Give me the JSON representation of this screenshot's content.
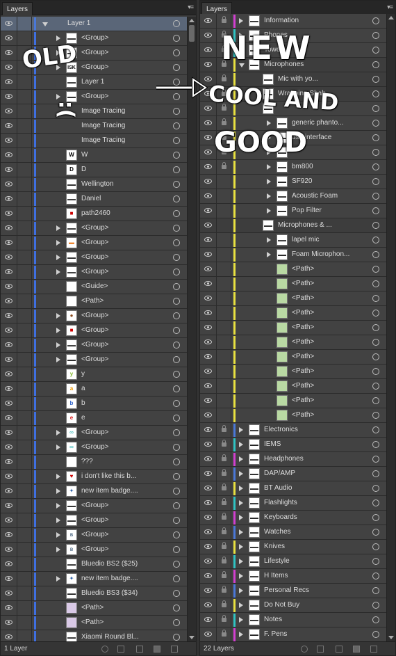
{
  "left": {
    "tab": "Layers",
    "footer_count": "1 Layer",
    "rows": [
      {
        "name": "Layer 1",
        "depth": 0,
        "expand": "down",
        "thumb": "",
        "sel": true,
        "lock": false,
        "color": "#4a78d8"
      },
      {
        "name": "<Group>",
        "depth": 1,
        "expand": "right",
        "thumb": "img",
        "color": "#3f6fe0"
      },
      {
        "name": "<Group>",
        "depth": 1,
        "expand": "right",
        "thumb": "img",
        "color": "#3f6fe0"
      },
      {
        "name": "<Group>",
        "depth": 1,
        "expand": "right",
        "thumb": "ISK",
        "color": "#3f6fe0"
      },
      {
        "name": "Layer 1",
        "depth": 1,
        "expand": "",
        "thumb": "img",
        "color": "#3f6fe0"
      },
      {
        "name": "<Group>",
        "depth": 1,
        "expand": "right",
        "thumb": "img",
        "color": "#3f6fe0"
      },
      {
        "name": "Image Tracing",
        "depth": 1,
        "expand": "",
        "thumb": "",
        "color": "#3f6fe0"
      },
      {
        "name": "Image Tracing",
        "depth": 1,
        "expand": "",
        "thumb": "",
        "color": "#3f6fe0"
      },
      {
        "name": "Image Tracing",
        "depth": 1,
        "expand": "",
        "thumb": "",
        "color": "#3f6fe0"
      },
      {
        "name": "W",
        "depth": 1,
        "expand": "",
        "thumb": "W",
        "color": "#3f6fe0"
      },
      {
        "name": "D",
        "depth": 1,
        "expand": "",
        "thumb": "D",
        "color": "#3f6fe0"
      },
      {
        "name": "Wellington",
        "depth": 1,
        "expand": "",
        "thumb": "img",
        "color": "#3f6fe0"
      },
      {
        "name": "Daniel",
        "depth": 1,
        "expand": "",
        "thumb": "img",
        "color": "#3f6fe0"
      },
      {
        "name": "path2460",
        "depth": 1,
        "expand": "",
        "thumb": "red",
        "color": "#3f6fe0"
      },
      {
        "name": "<Group>",
        "depth": 1,
        "expand": "right",
        "thumb": "img",
        "color": "#3f6fe0"
      },
      {
        "name": "<Group>",
        "depth": 1,
        "expand": "right",
        "thumb": "multi",
        "color": "#3f6fe0"
      },
      {
        "name": "<Group>",
        "depth": 1,
        "expand": "right",
        "thumb": "img",
        "color": "#3f6fe0"
      },
      {
        "name": "<Group>",
        "depth": 1,
        "expand": "right",
        "thumb": "img",
        "color": "#3f6fe0"
      },
      {
        "name": "<Guide>",
        "depth": 1,
        "expand": "",
        "thumb": "blank",
        "color": "#3f6fe0"
      },
      {
        "name": "<Path>",
        "depth": 1,
        "expand": "",
        "thumb": "blank",
        "color": "#3f6fe0"
      },
      {
        "name": "<Group>",
        "depth": 1,
        "expand": "right",
        "thumb": "brown",
        "color": "#3f6fe0"
      },
      {
        "name": "<Group>",
        "depth": 1,
        "expand": "right",
        "thumb": "red",
        "color": "#3f6fe0"
      },
      {
        "name": "<Group>",
        "depth": 1,
        "expand": "right",
        "thumb": "img",
        "color": "#3f6fe0"
      },
      {
        "name": "<Group>",
        "depth": 1,
        "expand": "right",
        "thumb": "img",
        "color": "#3f6fe0"
      },
      {
        "name": "y",
        "depth": 1,
        "expand": "",
        "thumb": "y",
        "color": "#3f6fe0"
      },
      {
        "name": "a",
        "depth": 1,
        "expand": "",
        "thumb": "a",
        "color": "#3f6fe0"
      },
      {
        "name": "b",
        "depth": 1,
        "expand": "",
        "thumb": "b",
        "color": "#3f6fe0"
      },
      {
        "name": "e",
        "depth": 1,
        "expand": "",
        "thumb": "e",
        "color": "#3f6fe0"
      },
      {
        "name": "<Group>",
        "depth": 1,
        "expand": "right",
        "thumb": "teal",
        "color": "#3f6fe0"
      },
      {
        "name": "<Group>",
        "depth": 1,
        "expand": "right",
        "thumb": "teal",
        "color": "#3f6fe0"
      },
      {
        "name": "???",
        "depth": 1,
        "expand": "",
        "thumb": "blank",
        "color": "#3f6fe0"
      },
      {
        "name": "i don't like this b...",
        "depth": 1,
        "expand": "right",
        "thumb": "heart",
        "color": "#3f6fe0"
      },
      {
        "name": "new item badge....",
        "depth": 1,
        "expand": "right",
        "thumb": "badge",
        "color": "#3f6fe0"
      },
      {
        "name": "<Group>",
        "depth": 1,
        "expand": "right",
        "thumb": "img",
        "color": "#3f6fe0"
      },
      {
        "name": "<Group>",
        "depth": 1,
        "expand": "right",
        "thumb": "img",
        "color": "#3f6fe0"
      },
      {
        "name": "<Group>",
        "depth": 1,
        "expand": "right",
        "thumb": "bt",
        "color": "#3f6fe0"
      },
      {
        "name": "<Group>",
        "depth": 1,
        "expand": "right",
        "thumb": "bt",
        "color": "#3f6fe0"
      },
      {
        "name": "Bluedio BS2 ($25)",
        "depth": 1,
        "expand": "",
        "thumb": "img",
        "color": "#3f6fe0"
      },
      {
        "name": "new item badge....",
        "depth": 1,
        "expand": "right",
        "thumb": "badge",
        "color": "#3f6fe0"
      },
      {
        "name": "Bluedio BS3 ($34)",
        "depth": 1,
        "expand": "",
        "thumb": "img",
        "color": "#3f6fe0"
      },
      {
        "name": "<Path>",
        "depth": 1,
        "expand": "",
        "thumb": "lilac",
        "color": "#3f6fe0"
      },
      {
        "name": "<Path>",
        "depth": 1,
        "expand": "",
        "thumb": "lilac",
        "color": "#3f6fe0"
      },
      {
        "name": "Xiaomi Round Bl...",
        "depth": 1,
        "expand": "",
        "thumb": "img",
        "color": "#3f6fe0"
      }
    ]
  },
  "right": {
    "tab": "Layers",
    "footer_count": "22 Layers",
    "rows": [
      {
        "name": "Information",
        "depth": 0,
        "expand": "right",
        "thumb": "img",
        "lock": true,
        "color": "#d23fd0"
      },
      {
        "name": "Phones",
        "depth": 0,
        "expand": "right",
        "thumb": "img",
        "lock": true,
        "color": "#2fc3c3"
      },
      {
        "name": "Tower",
        "depth": 0,
        "expand": "right",
        "thumb": "img",
        "lock": true,
        "color": "#2fc3c3"
      },
      {
        "name": "Microphones",
        "depth": 0,
        "expand": "down",
        "thumb": "img",
        "lock": true,
        "color": "#e8e040",
        "dim": true
      },
      {
        "name": "Mic with yo...",
        "depth": 1,
        "expand": "",
        "thumb": "img",
        "lock": true,
        "color": "#e8e040",
        "dim": true
      },
      {
        "name": "Wrapping Shab...",
        "depth": 1,
        "expand": "",
        "thumb": "img",
        "lock": true,
        "color": "#e8e040",
        "dim": true
      },
      {
        "name": "",
        "depth": 1,
        "expand": "",
        "thumb": "img",
        "lock": true,
        "color": "#e8e040"
      },
      {
        "name": "generic phanto...",
        "depth": 2,
        "expand": "right",
        "thumb": "img",
        "lock": true,
        "color": "#e8e040"
      },
      {
        "name": "usb interface",
        "depth": 2,
        "expand": "right",
        "thumb": "img",
        "lock": true,
        "color": "#e8e040"
      },
      {
        "name": "",
        "depth": 2,
        "expand": "right",
        "thumb": "img",
        "lock": true,
        "color": "#e8e040"
      },
      {
        "name": "bm800",
        "depth": 2,
        "expand": "right",
        "thumb": "img",
        "lock": true,
        "color": "#e8e040"
      },
      {
        "name": "SF920",
        "depth": 2,
        "expand": "right",
        "thumb": "img",
        "lock": false,
        "color": "#e8e040"
      },
      {
        "name": "Acoustic Foam",
        "depth": 2,
        "expand": "right",
        "thumb": "img",
        "lock": false,
        "color": "#e8e040"
      },
      {
        "name": "Pop Filter",
        "depth": 2,
        "expand": "right",
        "thumb": "img",
        "lock": false,
        "color": "#e8e040"
      },
      {
        "name": "Microphones & ...",
        "depth": 1,
        "expand": "",
        "thumb": "img",
        "lock": false,
        "color": "#e8e040",
        "dim": true
      },
      {
        "name": "lapel mic",
        "depth": 2,
        "expand": "right",
        "thumb": "img",
        "lock": false,
        "color": "#e8e040"
      },
      {
        "name": "Foam Microphon...",
        "depth": 2,
        "expand": "right",
        "thumb": "img",
        "lock": false,
        "color": "#e8e040"
      },
      {
        "name": "<Path>",
        "depth": 2,
        "expand": "",
        "thumb": "green",
        "lock": false,
        "color": "#e8e040"
      },
      {
        "name": "<Path>",
        "depth": 2,
        "expand": "",
        "thumb": "green",
        "lock": false,
        "color": "#e8e040"
      },
      {
        "name": "<Path>",
        "depth": 2,
        "expand": "",
        "thumb": "green",
        "lock": false,
        "color": "#e8e040"
      },
      {
        "name": "<Path>",
        "depth": 2,
        "expand": "",
        "thumb": "green",
        "lock": false,
        "color": "#e8e040"
      },
      {
        "name": "<Path>",
        "depth": 2,
        "expand": "",
        "thumb": "green",
        "lock": false,
        "color": "#e8e040"
      },
      {
        "name": "<Path>",
        "depth": 2,
        "expand": "",
        "thumb": "green",
        "lock": false,
        "color": "#e8e040"
      },
      {
        "name": "<Path>",
        "depth": 2,
        "expand": "",
        "thumb": "green",
        "lock": false,
        "color": "#e8e040"
      },
      {
        "name": "<Path>",
        "depth": 2,
        "expand": "",
        "thumb": "green",
        "lock": false,
        "color": "#e8e040"
      },
      {
        "name": "<Path>",
        "depth": 2,
        "expand": "",
        "thumb": "green",
        "lock": false,
        "color": "#e8e040"
      },
      {
        "name": "<Path>",
        "depth": 2,
        "expand": "",
        "thumb": "green",
        "lock": false,
        "color": "#e8e040"
      },
      {
        "name": "<Path>",
        "depth": 2,
        "expand": "",
        "thumb": "green",
        "lock": false,
        "color": "#e8e040"
      },
      {
        "name": "Electronics",
        "depth": 0,
        "expand": "right",
        "thumb": "img",
        "lock": true,
        "color": "#4a78d8"
      },
      {
        "name": "IEMS",
        "depth": 0,
        "expand": "right",
        "thumb": "img",
        "lock": true,
        "color": "#2fc3c3"
      },
      {
        "name": "Headphones",
        "depth": 0,
        "expand": "right",
        "thumb": "img",
        "lock": true,
        "color": "#d23fd0"
      },
      {
        "name": "DAP/AMP",
        "depth": 0,
        "expand": "right",
        "thumb": "img",
        "lock": true,
        "color": "#4a78d8"
      },
      {
        "name": "BT Audio",
        "depth": 0,
        "expand": "right",
        "thumb": "img",
        "lock": true,
        "color": "#e8e040"
      },
      {
        "name": "Flashlights",
        "depth": 0,
        "expand": "right",
        "thumb": "img",
        "lock": true,
        "color": "#2fc3c3"
      },
      {
        "name": "Keyboards",
        "depth": 0,
        "expand": "right",
        "thumb": "img",
        "lock": true,
        "color": "#d23fd0"
      },
      {
        "name": "Watches",
        "depth": 0,
        "expand": "right",
        "thumb": "img",
        "lock": true,
        "color": "#4a78d8"
      },
      {
        "name": "Knives",
        "depth": 0,
        "expand": "right",
        "thumb": "img",
        "lock": true,
        "color": "#e8e040"
      },
      {
        "name": "Lifestyle",
        "depth": 0,
        "expand": "right",
        "thumb": "img",
        "lock": true,
        "color": "#2fc3c3"
      },
      {
        "name": "H Items",
        "depth": 0,
        "expand": "right",
        "thumb": "img",
        "lock": true,
        "color": "#d23fd0"
      },
      {
        "name": "Personal Recs",
        "depth": 0,
        "expand": "right",
        "thumb": "img",
        "lock": true,
        "color": "#4a78d8"
      },
      {
        "name": "Do Not Buy",
        "depth": 0,
        "expand": "right",
        "thumb": "img",
        "lock": true,
        "color": "#e8e040"
      },
      {
        "name": "Notes",
        "depth": 0,
        "expand": "right",
        "thumb": "img",
        "lock": true,
        "color": "#2fc3c3"
      },
      {
        "name": "F. Pens",
        "depth": 0,
        "expand": "right",
        "thumb": "img",
        "lock": true,
        "color": "#d23fd0"
      }
    ]
  },
  "annotations": {
    "old": "OLD",
    "face": ":(",
    "new": "NEW",
    "cool": "COOL AND",
    "good": "GOOD"
  }
}
